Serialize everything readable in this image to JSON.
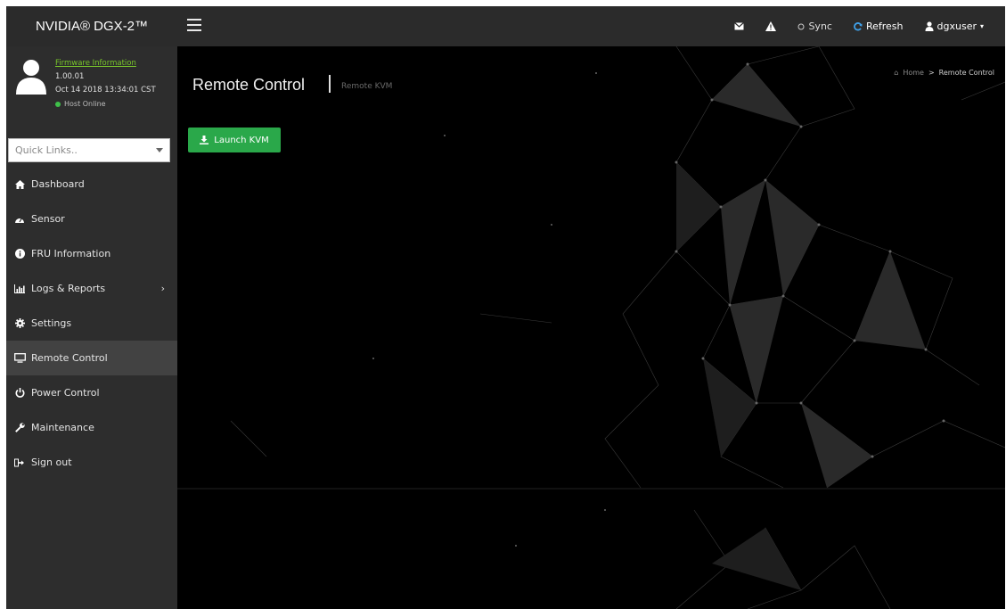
{
  "brand": {
    "title": "NVIDIA® DGX-2™"
  },
  "topbar": {
    "sync_label": "Sync",
    "refresh_label": "Refresh",
    "user_label": "dgxuser"
  },
  "profile": {
    "firmware_link": "Firmware Information",
    "version": "1.00.01",
    "datetime": "Oct 14 2018 13:34:01 CST",
    "host_status": "Host Online"
  },
  "quick_links": {
    "placeholder": "Quick Links.."
  },
  "sidebar": {
    "items": [
      {
        "label": "Dashboard",
        "icon": "home-icon"
      },
      {
        "label": "Sensor",
        "icon": "gauge-icon"
      },
      {
        "label": "FRU Information",
        "icon": "info-icon"
      },
      {
        "label": "Logs & Reports",
        "icon": "chart-icon"
      },
      {
        "label": "Settings",
        "icon": "gear-icon"
      },
      {
        "label": "Remote Control",
        "icon": "monitor-icon"
      },
      {
        "label": "Power Control",
        "icon": "power-icon"
      },
      {
        "label": "Maintenance",
        "icon": "wrench-icon"
      },
      {
        "label": "Sign out",
        "icon": "sign-out-icon"
      }
    ]
  },
  "main": {
    "title": "Remote Control",
    "subtitle": "Remote KVM",
    "breadcrumb_home": "Home",
    "breadcrumb_sep": ">",
    "breadcrumb_current": "Remote Control",
    "launch_label": "Launch KVM"
  },
  "colors": {
    "accent_green": "#2aa84a",
    "link_green": "#79c62b",
    "sidebar_bg": "#2d2d2d",
    "active_bg": "#424242"
  }
}
